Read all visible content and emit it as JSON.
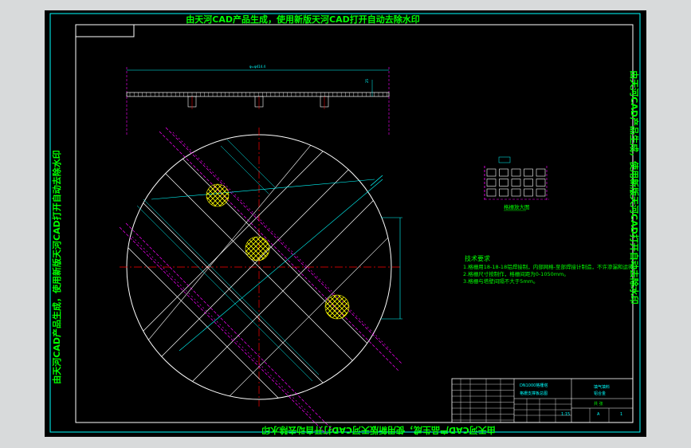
{
  "watermark": {
    "top": "由天河CAD产品生成，使用新版天河CAD打开自动去除水印",
    "bottom": "由天河CAD产品生成，使用新版天河CAD打开自动去除水印",
    "left": "由天河CAD产品生成，使用新版天河CAD打开自动去除水印",
    "right": "由天河CAD产品生成，使用新版天河CAD打开自动去除水印"
  },
  "dimensions": {
    "overall_width": "φ=φ414.4",
    "height": "25"
  },
  "detail": {
    "label": "格栅放大图"
  },
  "tech_notes": {
    "heading": "技术要求",
    "items": [
      "1.格栅用18-18-18铝焊接制，内部网格-至部焊接计制造，不许渗漏和运行。",
      "2.格栅尺寸按制作，格栅间距为0-1050mm。",
      "3.格栅与塔壁间隔不大于5mm。"
    ]
  },
  "title_block": {
    "drawing_name_1": "DN1000格栅塔",
    "drawing_name_2": "格栅支撑板总图",
    "company": "填气填料",
    "material": "铝合金",
    "qty_label": "共 张",
    "scale": "1:15",
    "sheet": "1",
    "revision": "A"
  },
  "colors": {
    "background": "#000000",
    "frame": "#00ffff",
    "outline": "#ffffff",
    "centerline": "#ff0000",
    "hidden": "#ff00ff",
    "hatch": "#ffff00",
    "watermark": "#00ff00"
  }
}
